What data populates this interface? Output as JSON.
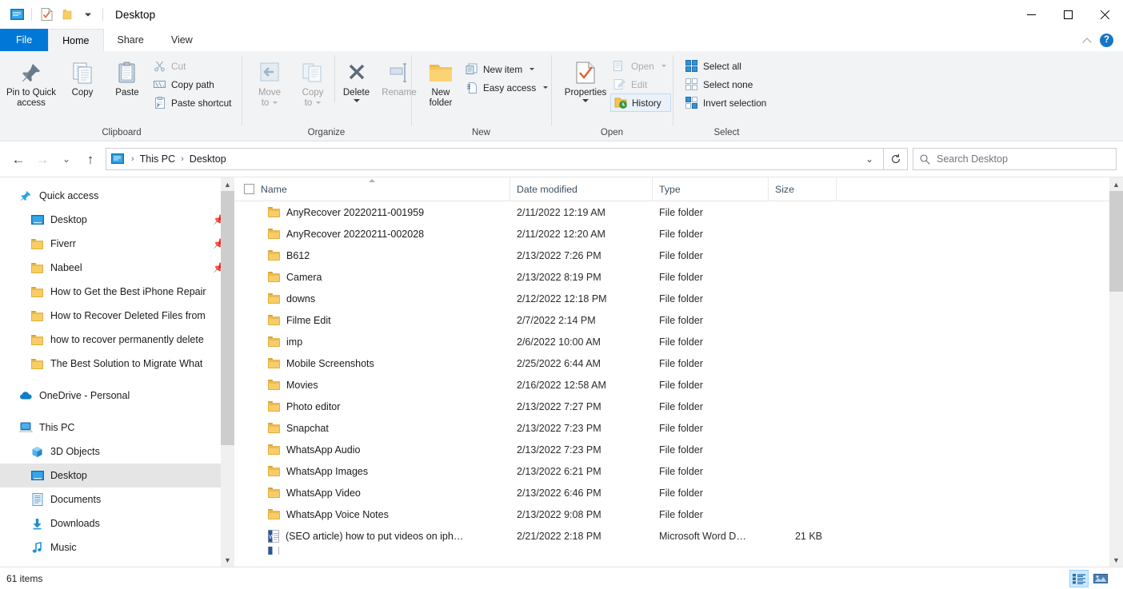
{
  "window": {
    "title": "Desktop",
    "quick_access_icons": [
      "explorer-icon",
      "properties-icon",
      "new-folder-icon",
      "customize-dropdown-icon"
    ],
    "minimize_label": "Minimize",
    "maximize_label": "Maximize",
    "close_label": "Close"
  },
  "tabs": [
    {
      "label": "File",
      "id": "file"
    },
    {
      "label": "Home",
      "id": "home"
    },
    {
      "label": "Share",
      "id": "share"
    },
    {
      "label": "View",
      "id": "view"
    }
  ],
  "ribbon": {
    "collapse_label": "Collapse the Ribbon",
    "help_label": "?",
    "groups": [
      {
        "name": "Clipboard",
        "big_buttons": [
          {
            "label": "Pin to Quick\naccess",
            "line1": "Pin to Quick",
            "line2": "access",
            "icon": "pin-icon"
          },
          {
            "label": "Copy",
            "line1": "Copy",
            "line2": "",
            "icon": "copy-icon"
          },
          {
            "label": "Paste",
            "line1": "Paste",
            "line2": "",
            "icon": "paste-icon"
          }
        ],
        "small_buttons": [
          {
            "label": "Cut",
            "icon": "scissors-icon",
            "disabled": true
          },
          {
            "label": "Copy path",
            "icon": "copy-path-icon",
            "disabled": false
          },
          {
            "label": "Paste shortcut",
            "icon": "paste-shortcut-icon",
            "disabled": false
          }
        ]
      },
      {
        "name": "Organize",
        "big_buttons": [
          {
            "label": "Move to",
            "line1": "Move",
            "line2": "to",
            "icon": "move-to-icon",
            "disabled": true,
            "caret": true
          },
          {
            "label": "Copy to",
            "line1": "Copy",
            "line2": "to",
            "icon": "copy-to-icon",
            "disabled": true,
            "caret": true
          },
          {
            "label": "Delete",
            "line1": "Delete",
            "line2": "",
            "icon": "delete-icon",
            "caret": true
          },
          {
            "label": "Rename",
            "line1": "Rename",
            "line2": "",
            "icon": "rename-icon",
            "disabled": true
          }
        ],
        "small_buttons": []
      },
      {
        "name": "New",
        "big_buttons": [
          {
            "label": "New folder",
            "line1": "New",
            "line2": "folder",
            "icon": "new-folder-icon"
          }
        ],
        "small_buttons": [
          {
            "label": "New item",
            "icon": "new-item-icon",
            "caret": true
          },
          {
            "label": "Easy access",
            "icon": "easy-access-icon",
            "caret": true
          }
        ]
      },
      {
        "name": "Open",
        "big_buttons": [
          {
            "label": "Properties",
            "line1": "Properties",
            "line2": "",
            "icon": "properties-icon",
            "caret": true
          }
        ],
        "small_buttons": [
          {
            "label": "Open",
            "icon": "open-icon",
            "disabled": true,
            "caret": true
          },
          {
            "label": "Edit",
            "icon": "edit-icon",
            "disabled": true
          },
          {
            "label": "History",
            "icon": "history-icon",
            "highlighted": true
          }
        ]
      },
      {
        "name": "Select",
        "big_buttons": [],
        "small_buttons": [
          {
            "label": "Select all",
            "icon": "select-all-icon"
          },
          {
            "label": "Select none",
            "icon": "select-none-icon"
          },
          {
            "label": "Invert selection",
            "icon": "invert-selection-icon"
          }
        ]
      }
    ]
  },
  "addressbar": {
    "back_label": "Back",
    "forward_label": "Forward",
    "recent_label": "Recent locations",
    "up_label": "Up",
    "breadcrumb": [
      "This PC",
      "Desktop"
    ],
    "dropdown_label": "Previous locations",
    "refresh_label": "Refresh",
    "search": {
      "placeholder": "Search Desktop",
      "value": "",
      "icon": "search-icon"
    }
  },
  "navpane": {
    "sections": [
      {
        "root": {
          "label": "Quick access",
          "icon": "pin-star-icon"
        },
        "children": [
          {
            "label": "Desktop",
            "icon": "desktop-icon",
            "pinned": true
          },
          {
            "label": "Fiverr",
            "icon": "folder-icon",
            "pinned": true
          },
          {
            "label": "Nabeel",
            "icon": "folder-icon",
            "pinned": true
          },
          {
            "label": "How to Get the Best iPhone Repair",
            "icon": "folder-icon",
            "pinned": false
          },
          {
            "label": "How to Recover Deleted Files from",
            "icon": "folder-icon",
            "pinned": false
          },
          {
            "label": "how to recover permanently delete",
            "icon": "folder-icon",
            "pinned": false
          },
          {
            "label": "The Best Solution to Migrate What",
            "icon": "folder-icon",
            "pinned": false
          }
        ]
      },
      {
        "root": {
          "label": "OneDrive - Personal",
          "icon": "onedrive-icon"
        },
        "children": []
      },
      {
        "root": {
          "label": "This PC",
          "icon": "thispc-icon"
        },
        "children": [
          {
            "label": "3D Objects",
            "icon": "3dobjects-icon",
            "pinned": false
          },
          {
            "label": "Desktop",
            "icon": "desktop-icon",
            "pinned": false,
            "selected": true
          },
          {
            "label": "Documents",
            "icon": "documents-icon",
            "pinned": false
          },
          {
            "label": "Downloads",
            "icon": "downloads-icon",
            "pinned": false
          },
          {
            "label": "Music",
            "icon": "music-icon",
            "pinned": false
          }
        ]
      }
    ]
  },
  "filelist": {
    "columns": [
      {
        "key": "name",
        "label": "Name"
      },
      {
        "key": "date",
        "label": "Date modified"
      },
      {
        "key": "type",
        "label": "Type"
      },
      {
        "key": "size",
        "label": "Size"
      }
    ],
    "sort_column": "Name",
    "sort_direction": "ascending",
    "rows": [
      {
        "name": "AnyRecover 20220211-001959",
        "date": "2/11/2022 12:19 AM",
        "type": "File folder",
        "size": "",
        "icon": "folder-icon"
      },
      {
        "name": "AnyRecover 20220211-002028",
        "date": "2/11/2022 12:20 AM",
        "type": "File folder",
        "size": "",
        "icon": "folder-icon"
      },
      {
        "name": "B612",
        "date": "2/13/2022 7:26 PM",
        "type": "File folder",
        "size": "",
        "icon": "folder-icon"
      },
      {
        "name": "Camera",
        "date": "2/13/2022 8:19 PM",
        "type": "File folder",
        "size": "",
        "icon": "folder-icon"
      },
      {
        "name": "downs",
        "date": "2/12/2022 12:18 PM",
        "type": "File folder",
        "size": "",
        "icon": "folder-icon"
      },
      {
        "name": "Filme Edit",
        "date": "2/7/2022 2:14 PM",
        "type": "File folder",
        "size": "",
        "icon": "folder-icon"
      },
      {
        "name": "imp",
        "date": "2/6/2022 10:00 AM",
        "type": "File folder",
        "size": "",
        "icon": "folder-icon"
      },
      {
        "name": "Mobile Screenshots",
        "date": "2/25/2022 6:44 AM",
        "type": "File folder",
        "size": "",
        "icon": "folder-icon"
      },
      {
        "name": "Movies",
        "date": "2/16/2022 12:58 AM",
        "type": "File folder",
        "size": "",
        "icon": "folder-icon"
      },
      {
        "name": "Photo editor",
        "date": "2/13/2022 7:27 PM",
        "type": "File folder",
        "size": "",
        "icon": "folder-icon"
      },
      {
        "name": "Snapchat",
        "date": "2/13/2022 7:23 PM",
        "type": "File folder",
        "size": "",
        "icon": "folder-icon"
      },
      {
        "name": "WhatsApp Audio",
        "date": "2/13/2022 7:23 PM",
        "type": "File folder",
        "size": "",
        "icon": "folder-icon"
      },
      {
        "name": "WhatsApp Images",
        "date": "2/13/2022 6:21 PM",
        "type": "File folder",
        "size": "",
        "icon": "folder-icon"
      },
      {
        "name": "WhatsApp Video",
        "date": "2/13/2022 6:46 PM",
        "type": "File folder",
        "size": "",
        "icon": "folder-icon"
      },
      {
        "name": "WhatsApp Voice Notes",
        "date": "2/13/2022 9:08 PM",
        "type": "File folder",
        "size": "",
        "icon": "folder-icon"
      },
      {
        "name": "(SEO article) how to put videos on iph…",
        "date": "2/21/2022 2:18 PM",
        "type": "Microsoft Word D…",
        "size": "21 KB",
        "icon": "word-doc-icon"
      }
    ]
  },
  "statusbar": {
    "item_count": "61 items",
    "views": [
      {
        "name": "details-view",
        "label": "Details view",
        "active": true
      },
      {
        "name": "large-icons-view",
        "label": "Large icons view",
        "active": false
      }
    ]
  },
  "colors": {
    "accent": "#0078d7",
    "ribbon_bg": "#f1f3f5",
    "selection": "#e5e5e5",
    "folder_yellow": "#f8cd68",
    "header_text": "#3c5063"
  }
}
